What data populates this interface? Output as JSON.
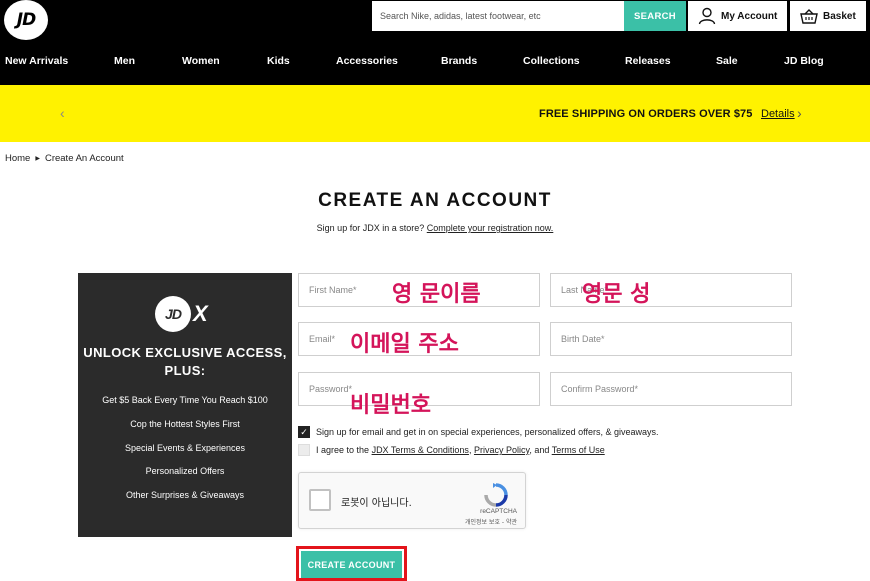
{
  "header": {
    "logo_text": "JD",
    "search": {
      "placeholder": "Search Nike, adidas, latest footwear, etc",
      "button_label": "SEARCH"
    },
    "account_label": "My Account",
    "basket_label": "Basket"
  },
  "nav": {
    "items": [
      "New Arrivals",
      "Men",
      "Women",
      "Kids",
      "Accessories",
      "Brands",
      "Collections",
      "Releases",
      "Sale",
      "JD Blog"
    ]
  },
  "promo": {
    "text": "FREE SHIPPING ON ORDERS OVER $75",
    "link": "Details"
  },
  "breadcrumb": {
    "home": "Home",
    "current": "Create An Account"
  },
  "page": {
    "title": "CREATE AN ACCOUNT",
    "subtitle_prefix": "Sign up for JDX in a store?",
    "subtitle_link": "Complete your registration now."
  },
  "jdx": {
    "logo_text": "JD",
    "logo_x": "X",
    "heading": "UNLOCK EXCLUSIVE ACCESS, PLUS:",
    "perks": [
      "Get $5 Back Every Time You Reach $100",
      "Cop the Hottest Styles First",
      "Special Events & Experiences",
      "Personalized Offers",
      "Other Surprises & Giveaways"
    ]
  },
  "form": {
    "first_name_placeholder": "First Name*",
    "last_name_placeholder": "Last Name*",
    "email_placeholder": "Email*",
    "birth_date_placeholder": "Birth Date*",
    "password_placeholder": "Password*",
    "confirm_password_placeholder": "Confirm Password*",
    "email_optin_label": "Sign up for email and get in on special experiences, personalized offers, & giveaways.",
    "email_optin_checked": true,
    "terms_prefix": "I agree to the",
    "terms_link": "JDX Terms & Conditions",
    "privacy_link": "Privacy Policy",
    "terms_and": "and",
    "terms_of_use_link": "Terms of Use",
    "terms_checked": false,
    "submit_label": "CREATE ACCOUNT"
  },
  "annotations": {
    "first_name": "영 문이름",
    "last_name": "영문 성",
    "email": "이메일 주소",
    "password": "비밀번호"
  },
  "recaptcha": {
    "label": "로봇이 아닙니다.",
    "brand": "reCAPTCHA",
    "privacy": "개인정보 보호 - 약관"
  },
  "colors": {
    "accent": "#3bc0a7",
    "promo_bg": "#fff200",
    "annotation": "#d4145a",
    "highlight": "#e3141b"
  }
}
